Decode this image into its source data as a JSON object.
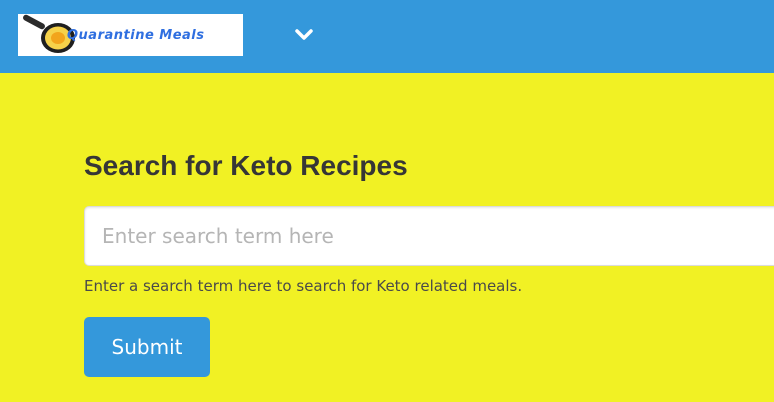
{
  "navbar": {
    "logo_text": "Quarantine Meals",
    "toggle_icon": "chevron-down-icon",
    "color": "#3498db"
  },
  "main": {
    "heading": "Search for Keto Recipes",
    "search": {
      "placeholder": "Enter search term here",
      "value": ""
    },
    "help_text": "Enter a search term here to search for Keto related meals.",
    "submit_label": "Submit"
  },
  "colors": {
    "page_background": "#f1f124",
    "accent": "#3498db",
    "heading_text": "#363636"
  }
}
